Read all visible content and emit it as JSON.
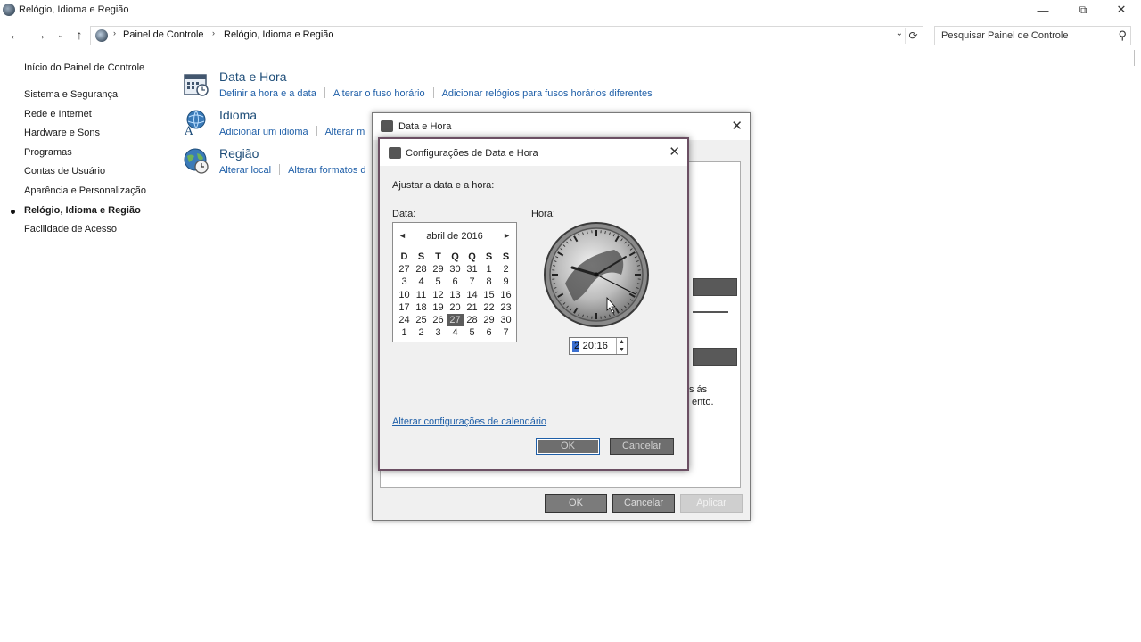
{
  "window": {
    "title": "Relógio, Idioma e Região",
    "minimize": "—",
    "restore": "⧉",
    "close": "✕"
  },
  "addressbar": {
    "back": "←",
    "forward": "→",
    "recent": "⌄",
    "up": "↑",
    "sep": "›",
    "crumbs": [
      "Painel de Controle",
      "Relógio, Idioma e Região"
    ],
    "dropdown": "⌄",
    "refresh": "⟳"
  },
  "search": {
    "placeholder": "Pesquisar Painel de Controle",
    "icon": "search-icon"
  },
  "leftnav": {
    "home": "Início do Painel de Controle",
    "items": [
      "Sistema e Segurança",
      "Rede e Internet",
      "Hardware e Sons",
      "Programas",
      "Contas de Usuário",
      "Aparência e Personalização",
      "Relógio, Idioma e Região",
      "Facilidade de Acesso"
    ]
  },
  "categories": [
    {
      "title": "Data e Hora",
      "links": [
        "Definir a hora e a data",
        "Alterar o fuso horário",
        "Adicionar relógios para fusos horários diferentes"
      ]
    },
    {
      "title": "Idioma",
      "links": [
        "Adicionar um idioma",
        "Alterar m"
      ]
    },
    {
      "title": "Região",
      "links": [
        "Alterar local",
        "Alterar formatos d"
      ]
    }
  ],
  "outer_dialog": {
    "title": "Data e Hora",
    "close": "✕",
    "ghost_text": "s ás\n ento.",
    "buttons": {
      "ok": "OK",
      "cancel": "Cancelar",
      "apply": "Aplicar"
    }
  },
  "inner_dialog": {
    "title": "Configurações de Data e Hora",
    "close": "✕",
    "heading": "Ajustar a data e a hora:",
    "date_label": "Data:",
    "time_label": "Hora:",
    "calendar": {
      "month": "abril de 2016",
      "prev": "◄",
      "next": "►",
      "weekdays": [
        "D",
        "S",
        "T",
        "Q",
        "Q",
        "S",
        "S"
      ],
      "weeks": [
        [
          "27",
          "28",
          "29",
          "30",
          "31",
          "1",
          "2"
        ],
        [
          "3",
          "4",
          "5",
          "6",
          "7",
          "8",
          "9"
        ],
        [
          "10",
          "11",
          "12",
          "13",
          "14",
          "15",
          "16"
        ],
        [
          "17",
          "18",
          "19",
          "20",
          "21",
          "22",
          "23"
        ],
        [
          "24",
          "25",
          "26",
          "27",
          "28",
          "29",
          "30"
        ],
        [
          "1",
          "2",
          "3",
          "4",
          "5",
          "6",
          "7"
        ]
      ],
      "selected_day": "27"
    },
    "time_value": "2 20:16",
    "spin_up": "▲",
    "spin_down": "▼",
    "calendar_link": "Alterar configurações de calendário",
    "buttons": {
      "ok": "OK",
      "cancel": "Cancelar"
    }
  },
  "colors": {
    "link": "#1f5fa8",
    "category_title": "#1f4e79",
    "selected_day_bg": "#5c5c5c"
  }
}
